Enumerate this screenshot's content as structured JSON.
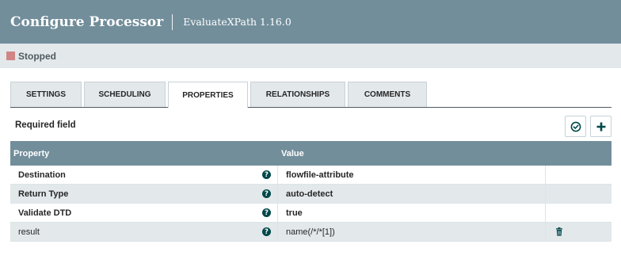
{
  "header": {
    "title": "Configure Processor",
    "subtitle": "EvaluateXPath 1.16.0"
  },
  "status": {
    "text": "Stopped",
    "color": "#d18686"
  },
  "tabs": [
    {
      "label": "SETTINGS",
      "active": false
    },
    {
      "label": "SCHEDULING",
      "active": false
    },
    {
      "label": "PROPERTIES",
      "active": true
    },
    {
      "label": "RELATIONSHIPS",
      "active": false
    },
    {
      "label": "COMMENTS",
      "active": false
    }
  ],
  "required_label": "Required field",
  "toolbar": {
    "verify_icon": "check-circle-icon",
    "add_icon": "plus-icon"
  },
  "table": {
    "headers": {
      "property": "Property",
      "value": "Value"
    },
    "rows": [
      {
        "name": "Destination",
        "value": "flowfile-attribute",
        "required": true,
        "help_glyph": "?"
      },
      {
        "name": "Return Type",
        "value": "auto-detect",
        "required": true,
        "help_glyph": "?"
      },
      {
        "name": "Validate DTD",
        "value": "true",
        "required": true,
        "help_glyph": "?"
      },
      {
        "name": "result",
        "value": "name(/*/*[1])",
        "required": false,
        "help_glyph": "?",
        "deletable": true
      }
    ]
  },
  "colors": {
    "header_bg": "#728e9b",
    "status_bg": "#e3e8eb",
    "accent_dark": "#004849"
  }
}
